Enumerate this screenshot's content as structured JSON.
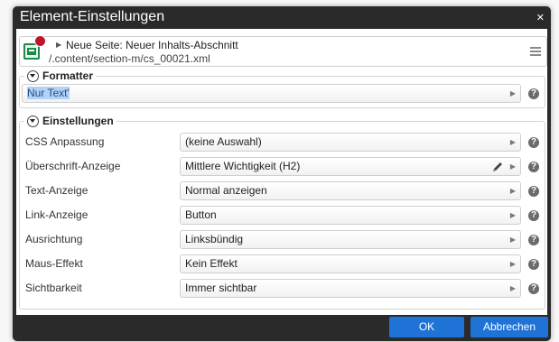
{
  "dialog": {
    "title": "Element-Einstellungen",
    "close_icon": "close-icon"
  },
  "resource": {
    "icon": "content-section-icon",
    "title": "Neue Seite: Neuer Inhalts-Abschnitt",
    "path": "/.content/section-m/cs_00021.xml",
    "menu_icon": "hamburger-menu-icon"
  },
  "formatter": {
    "legend": "Formatter",
    "value": "Nur Text'"
  },
  "settings": {
    "legend": "Einstellungen",
    "rows": [
      {
        "label": "CSS Anpassung",
        "value": "(keine Auswahl)",
        "editable": false
      },
      {
        "label": "Überschrift-Anzeige",
        "value": "Mittlere Wichtigkeit (H2)",
        "editable": true
      },
      {
        "label": "Text-Anzeige",
        "value": "Normal anzeigen",
        "editable": false
      },
      {
        "label": "Link-Anzeige",
        "value": "Button",
        "editable": false
      },
      {
        "label": "Ausrichtung",
        "value": "Linksbündig",
        "editable": false
      },
      {
        "label": "Maus-Effekt",
        "value": "Kein Effekt",
        "editable": false
      },
      {
        "label": "Sichtbarkeit",
        "value": "Immer sichtbar",
        "editable": false
      }
    ]
  },
  "buttons": {
    "ok": "OK",
    "cancel": "Abbrechen"
  },
  "colors": {
    "titlebar_bg": "#2a2a2a",
    "button_blue": "#1f73d6",
    "badge_red": "#c0142b",
    "icon_green": "#1b8a4b"
  }
}
